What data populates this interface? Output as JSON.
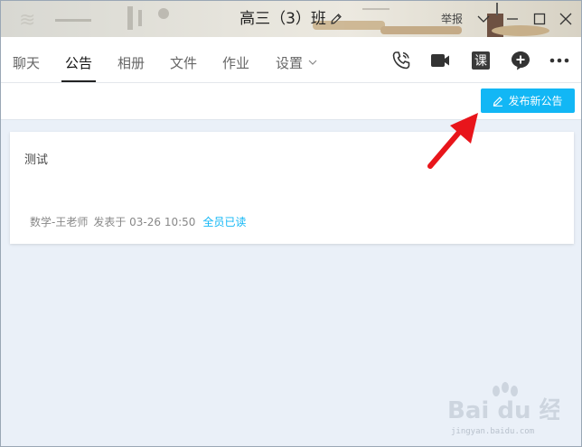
{
  "window": {
    "title": "高三（3）班",
    "report": "举报"
  },
  "tabs": [
    {
      "label": "聊天",
      "active": false
    },
    {
      "label": "公告",
      "active": true
    },
    {
      "label": "相册",
      "active": false
    },
    {
      "label": "文件",
      "active": false
    },
    {
      "label": "作业",
      "active": false
    },
    {
      "label": "设置",
      "active": false
    }
  ],
  "toolbar": {
    "icons": [
      "phone-icon",
      "video-call-icon",
      "course-icon",
      "add-icon",
      "more-icon"
    ],
    "course_glyph": "课"
  },
  "actions": {
    "publish_label": "发布新公告"
  },
  "announcement": {
    "title": "测试",
    "author": "数学-王老师",
    "posted_at": "发表于 03-26 10:50",
    "read_status": "全员已读"
  },
  "watermark": {
    "brand": "Bai du 经验",
    "url": "jingyan.baidu.com"
  },
  "colors": {
    "accent": "#12b7f5",
    "background": "#eaf0f8",
    "arrow": "#e8151b"
  }
}
